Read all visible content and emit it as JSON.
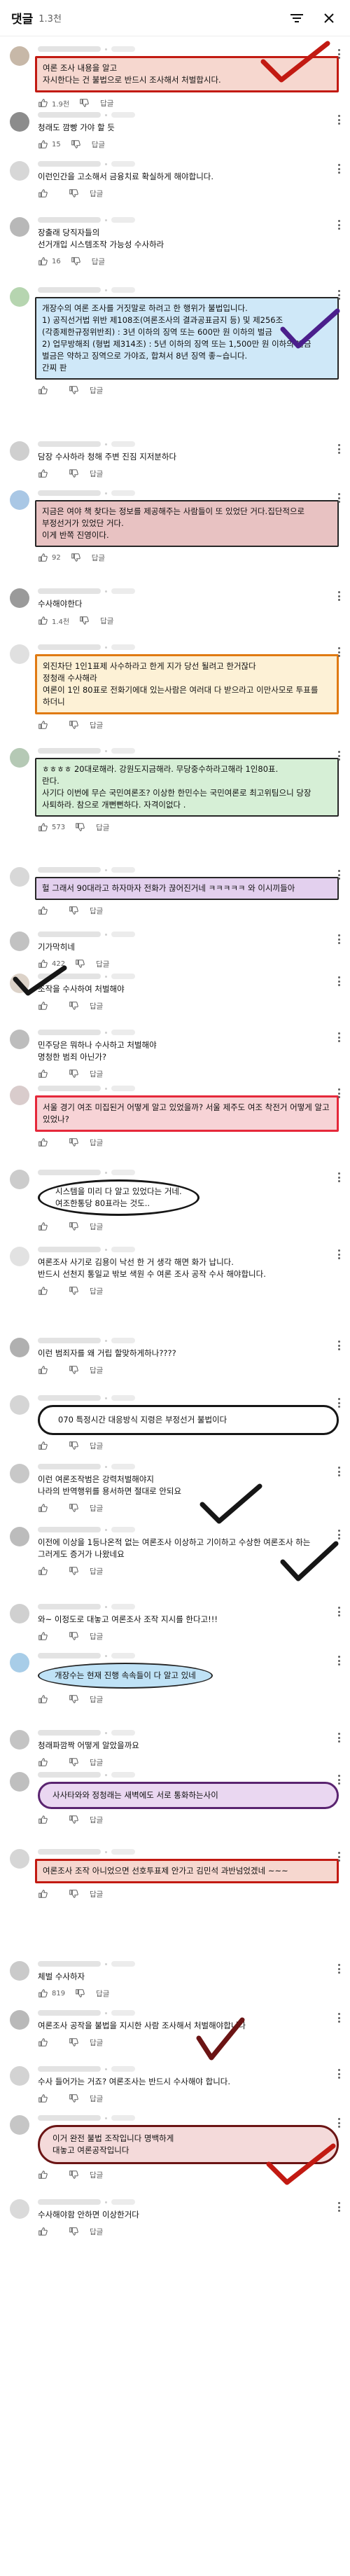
{
  "header": {
    "title": "댓글",
    "count": "1.3천"
  },
  "comments": [
    {
      "text": "여론 조사 내용을 알고\n자시한다는 건 불법으로 반드시 조사해서 처벌합시다.",
      "likes": "1.9천",
      "reply": "답글"
    },
    {
      "text": "청래도 깜빵 가야 할 듯",
      "likes": "15",
      "reply": "답글"
    },
    {
      "text": "이런인간을 고소해서 금융치료  확실하게 해야합니다.",
      "likes": "",
      "reply": "답글"
    },
    {
      "text": "장출래 당직자들의\n선거개입 시스템조작 가능성 수사하라",
      "likes": "16",
      "reply": "답글"
    },
    {
      "text": "개장수의 여론 조사를 거짓말로 하려고 한 행위가 불법입니다.\n1) 공직선거법 위반 제108조(여론조사의 결과공표금지 등) 및 제256조(각종제한규정위반죄) : 3년 이하의 징역 또는 600만 원 이하의 벌금\n2) 업무방해죄 (형법 제314조) : 5년 이하의 징역 또는 1,500만 원 이하의 벌금\n벌금은 약하고 징역으로 가야죠, 합쳐서 8년 징역 좋~습니다.\n간찌 판",
      "likes": "",
      "reply": "답글"
    },
    {
      "text": "담장 수사하라 청해 주변 진짐 지저분하다",
      "likes": "",
      "reply": "답글"
    },
    {
      "text": "지금은 여야 책 찾다는 정보를 제공해주는 사람들이 또 있었단 거다.집단적으로\n부정선거가 있었단 거다.\n이게 반쪽 진영이다.",
      "likes": "92",
      "reply": "답글"
    },
    {
      "text": "수사해야한다",
      "likes": "1.4천",
      "reply": "답글"
    },
    {
      "text": "외진차단 1인1표제 사수하라고 한게 지가 당선 될려고 한거잖다\n정청래 수사해라\n여론이 1인 80표로 전화기에대 있는사람은 여러대 다 받으라고 이만사모로 투표를 하더니",
      "likes": "",
      "reply": "답글"
    },
    {
      "text": "ㅎㅎㅎㅎ 20대로해라. 강원도지금해라. 무당중수하라고해라  1인80표.\n란다.\n사기다 이번에 무슨 국민여론조? 이상한  한민수는 국민여론로 최고위팀으니 당장 사퇴하라. 참으로 개뻔뻔하다. 자격이없다 .",
      "likes": "573",
      "reply": "답글"
    },
    {
      "text": "헐 그래서 90대라고 하자마자 전화가 끊어진거네 ㅋㅋㅋㅋㅋ 와 이시끼들아",
      "likes": "",
      "reply": "답글"
    },
    {
      "text": "기가막히네",
      "likes": "422",
      "reply": "답글"
    },
    {
      "text": "조작을 수사하여 처벌해야",
      "likes": "",
      "reply": "답글"
    },
    {
      "text": "민주당은 뭐하나 수사하고 처벌해야\n명청한 범죄 아닌가?",
      "likes": "",
      "reply": "답글"
    },
    {
      "text": "서울 경기 여조 미집된거 어떻게 알고 있었을까? 서울 제주도 여조 착전거 어떻게 알고 있었나?",
      "likes": "",
      "reply": "답글"
    },
    {
      "text": "시스템을 미리 다 알고 있었다는 거네.\n여조한통당 80표라는 것도..",
      "likes": "",
      "reply": "답글"
    },
    {
      "text": "여론조사 사기로 김용이 낙선 한 거 생각 해면 화가 납니다.\n반드시 선천지 통일교 밖보 색원 수 여론 조사 공작 수사 해야합니다.",
      "likes": "",
      "reply": "답글"
    },
    {
      "text": "이런 범죄자를 왜 거립 할맞하게하나????",
      "likes": "",
      "reply": "답글"
    },
    {
      "text": "070 특정시간 대응방식 지령은 부정선거 불법이다",
      "likes": "",
      "reply": "답글"
    },
    {
      "text": "이런 여론조작범은 강력처벌해야지\n나라의 반역행위를 용서하면 절대로 안되요",
      "likes": "",
      "reply": "답글"
    },
    {
      "text": "이전에 이상을 1등나온적 없는 여론조사 이상하고 기이하고 수상한 여론조사 하는\n그러게도 증거가 나왔네요",
      "likes": "",
      "reply": "답글"
    },
    {
      "text": "와~ 이정도로 대놓고 여론조사 조작 지시를 한다고!!!",
      "likes": "",
      "reply": "답글"
    },
    {
      "text": "개장수는 현재 진행 속속들이 다 알고 있네",
      "likes": "",
      "reply": "답글"
    },
    {
      "text": "청래파깜짝 어떻게 알았을까요",
      "likes": "",
      "reply": "답글"
    },
    {
      "text": "사사타와와 정청래는 새벽에도 서로 통화하는사이",
      "likes": "",
      "reply": "답글"
    },
    {
      "text": "여론조사 조작 아니었으면 선호투표제 안가고 김민석 과반넘었겠네 ~~~",
      "likes": "",
      "reply": "답글"
    },
    {
      "text": "체벌 수사하자",
      "likes": "819",
      "reply": "답글"
    },
    {
      "text": "여론조사 공작을 불법을 지시한 사람 조사해서 처벌해야합니다",
      "likes": "",
      "reply": "답글"
    },
    {
      "text": "수사 들어가는 거죠? 여론조사는 반드시 수사해야 합니다.",
      "likes": "",
      "reply": "답글"
    },
    {
      "text": "이거 완전 불법  조작입니다 명백하게\n대놓고 여론공작입니다",
      "likes": "",
      "reply": "답글"
    },
    {
      "text": "수사해야함 안하면 이상한거다",
      "likes": "",
      "reply": "답글"
    }
  ],
  "colors": {
    "red": "#c21a12",
    "orange": "#e07a12",
    "purple_check": "#4b1f8c",
    "black_check": "#161616",
    "link_blue": "#065fd4"
  }
}
